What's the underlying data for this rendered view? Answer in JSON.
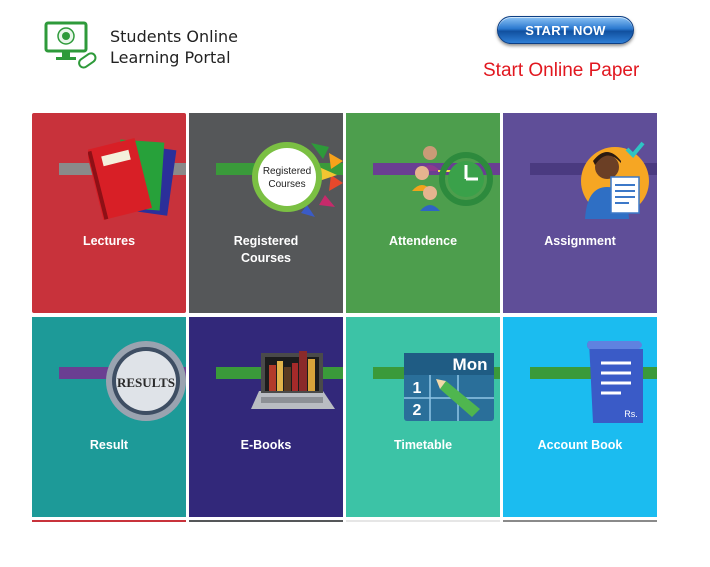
{
  "header": {
    "brand_line1": "Students Online",
    "brand_line2": "Learning Portal",
    "start_button": "START NOW",
    "start_link": "Start Online Paper"
  },
  "tiles": [
    {
      "label": "Lectures",
      "icon": "notebooks-icon",
      "color": "#c8323b",
      "bar": "#8a8a8a"
    },
    {
      "label": "Registered Courses",
      "line1": "Registered",
      "line2": "Courses",
      "icon": "registered-courses-icon",
      "badge_line1": "Registered",
      "badge_line2": "Courses",
      "color": "#555759",
      "bar": "#3a9a3a"
    },
    {
      "label": "Attendence",
      "icon": "attendance-clock-icon",
      "color": "#4d9e4d",
      "bar": "#6a3f92"
    },
    {
      "label": "Assignment",
      "icon": "assignment-student-icon",
      "color": "#5f4e98",
      "bar": "#4a3a80"
    },
    {
      "label": "Result",
      "icon": "results-magnifier-icon",
      "badge": "RESULTS",
      "color": "#1d9a98",
      "bar": "#6a3f92"
    },
    {
      "label": "E-Books",
      "icon": "ebooks-laptop-icon",
      "color": "#32287a",
      "bar": "#3a9a3a"
    },
    {
      "label": "Timetable",
      "icon": "calendar-icon",
      "calendar_day": "Mon",
      "calendar_n1": "1",
      "calendar_n2": "2",
      "color": "#3cc3a6",
      "bar": "#3a9a3a"
    },
    {
      "label": "Account Book",
      "icon": "account-book-icon",
      "currency": "Rs.",
      "color": "#1bbcf0",
      "bar": "#3a9a3a"
    }
  ]
}
